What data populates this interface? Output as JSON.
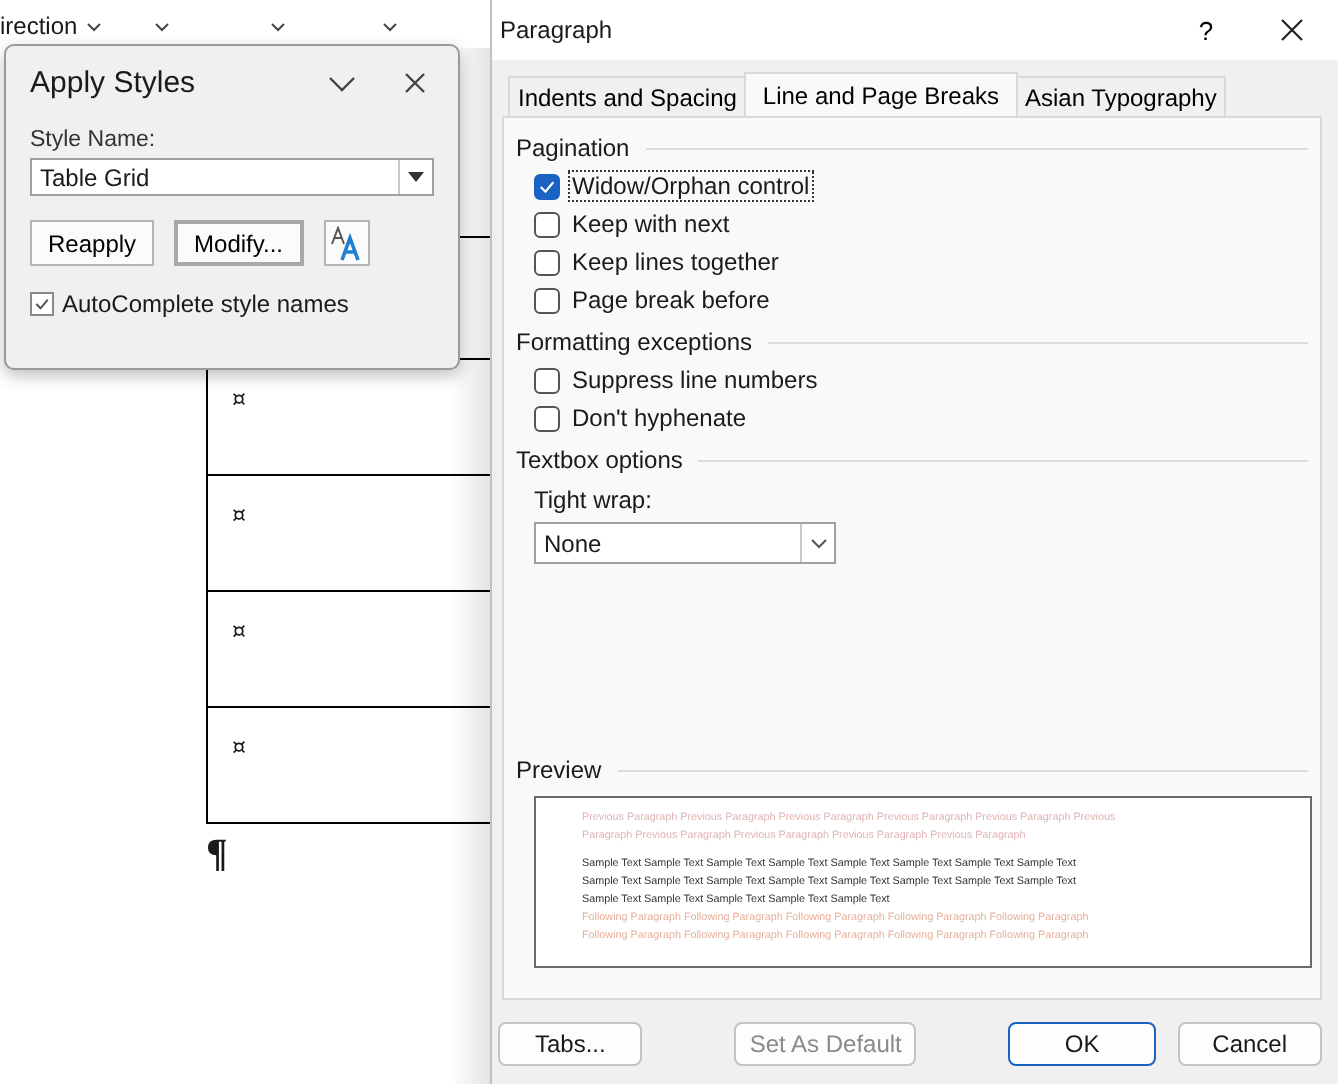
{
  "document": {
    "ribbon_label": "irection",
    "table_rows": [
      "¤",
      "¤",
      "¤",
      "¤"
    ],
    "paragraph_mark": "¶"
  },
  "apply_styles": {
    "title": "Apply Styles",
    "style_name_label": "Style Name:",
    "style_name_value": "Table Grid",
    "buttons": [
      {
        "label": "Reapply",
        "default": false
      },
      {
        "label": "Modify...",
        "default": true
      }
    ],
    "autocomplete": {
      "label": "AutoComplete style names",
      "checked": true
    }
  },
  "paragraph_dialog": {
    "title": "Paragraph",
    "help": "?",
    "tabs": [
      {
        "label": "Indents and Spacing",
        "selected": false
      },
      {
        "label": "Line and Page Breaks",
        "selected": true
      },
      {
        "label": "Asian Typography",
        "selected": false
      }
    ],
    "sections": [
      {
        "title": "Pagination",
        "items": [
          {
            "label": "Widow/Orphan control",
            "checked": true,
            "focused": true
          },
          {
            "label": "Keep with next",
            "checked": false,
            "focused": false
          },
          {
            "label": "Keep lines together",
            "checked": false,
            "focused": false
          },
          {
            "label": "Page break before",
            "checked": false,
            "focused": false
          }
        ]
      },
      {
        "title": "Formatting exceptions",
        "items": [
          {
            "label": "Suppress line numbers",
            "checked": false,
            "focused": false
          },
          {
            "label": "Don't hyphenate",
            "checked": false,
            "focused": false
          }
        ]
      }
    ],
    "textbox_options": {
      "title": "Textbox options",
      "field_label": "Tight wrap:",
      "value": "None"
    },
    "preview": {
      "title": "Preview",
      "lines": [
        {
          "kind": "previous",
          "text": "Previous Paragraph Previous Paragraph Previous Paragraph Previous Paragraph Previous Paragraph Previous"
        },
        {
          "kind": "previous",
          "text": "Paragraph Previous Paragraph Previous Paragraph Previous Paragraph Previous Paragraph"
        },
        {
          "kind": "sample",
          "text": "Sample Text Sample Text Sample Text Sample Text Sample Text Sample Text Sample Text Sample Text"
        },
        {
          "kind": "sample",
          "text": "Sample Text Sample Text Sample Text Sample Text Sample Text Sample Text Sample Text Sample Text"
        },
        {
          "kind": "sample",
          "text": "Sample Text Sample Text Sample Text Sample Text Sample Text"
        },
        {
          "kind": "following",
          "text": "Following Paragraph Following Paragraph Following Paragraph Following Paragraph Following Paragraph"
        },
        {
          "kind": "following",
          "text": "Following Paragraph Following Paragraph Following Paragraph Following Paragraph Following Paragraph"
        }
      ]
    },
    "buttons": [
      {
        "label": "Tabs...",
        "kind": "normal"
      },
      {
        "label": "Set As Default",
        "kind": "disabled"
      },
      {
        "label": "OK",
        "kind": "default"
      },
      {
        "label": "Cancel",
        "kind": "normal"
      }
    ]
  }
}
